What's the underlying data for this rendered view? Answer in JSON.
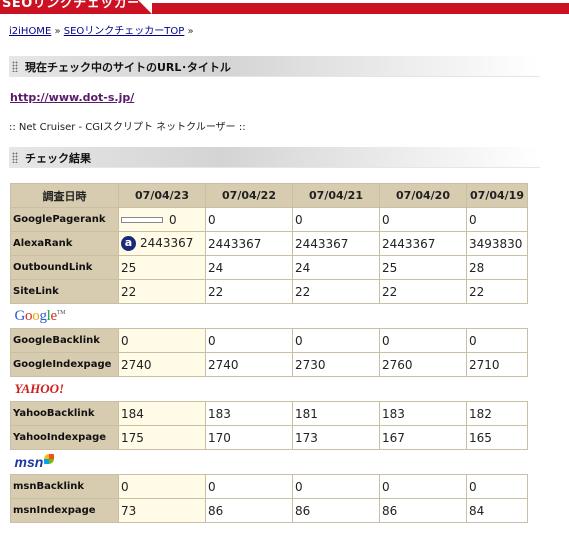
{
  "app": {
    "title": "SEOリンクチェッカー"
  },
  "breadcrumb": [
    {
      "label": "i2iHOME"
    },
    {
      "label": "SEOリンクチェッカーTOP"
    }
  ],
  "breadcrumb_sep": "»",
  "section_current": {
    "label": "現在チェック中のサイトのURL･タイトル"
  },
  "site": {
    "url": "http://www.dot-s.jp/",
    "title": ":: Net Cruiser - CGIスクリプト ネットクルーザー ::"
  },
  "section_results": {
    "label": "チェック結果"
  },
  "table": {
    "header_label": "調査日時",
    "dates": [
      "07/04/23",
      "07/04/22",
      "07/04/21",
      "07/04/20",
      "07/04/19"
    ],
    "general_rows": [
      {
        "label": "GooglePagerank",
        "values": [
          "0",
          "0",
          "0",
          "0",
          "0"
        ],
        "icon": "pagerank-bar"
      },
      {
        "label": "AlexaRank",
        "values": [
          "2443367",
          "2443367",
          "2443367",
          "2443367",
          "3493830"
        ],
        "icon": "alexa-icon"
      },
      {
        "label": "OutboundLink",
        "values": [
          "25",
          "24",
          "24",
          "25",
          "28"
        ]
      },
      {
        "label": "SiteLink",
        "values": [
          "22",
          "22",
          "22",
          "22",
          "22"
        ]
      }
    ],
    "google": {
      "logo": "Google",
      "rows": [
        {
          "label": "GoogleBacklink",
          "values": [
            "0",
            "0",
            "0",
            "0",
            "0"
          ]
        },
        {
          "label": "GoogleIndexpage",
          "values": [
            "2740",
            "2740",
            "2730",
            "2760",
            "2710"
          ]
        }
      ]
    },
    "yahoo": {
      "logo": "YAHOO!",
      "rows": [
        {
          "label": "YahooBacklink",
          "values": [
            "184",
            "183",
            "181",
            "183",
            "182"
          ]
        },
        {
          "label": "YahooIndexpage",
          "values": [
            "175",
            "170",
            "173",
            "167",
            "165"
          ]
        }
      ]
    },
    "msn": {
      "logo": "msn",
      "rows": [
        {
          "label": "msnBacklink",
          "values": [
            "0",
            "0",
            "0",
            "0",
            "0"
          ]
        },
        {
          "label": "msnIndexpage",
          "values": [
            "73",
            "86",
            "86",
            "86",
            "84"
          ]
        }
      ]
    }
  },
  "colors": {
    "topbar": "#cc1122",
    "table_header": "#d7ccb0",
    "current_column": "#fffbe6",
    "link": "#00008b",
    "visited_link": "#5a1a6a"
  }
}
